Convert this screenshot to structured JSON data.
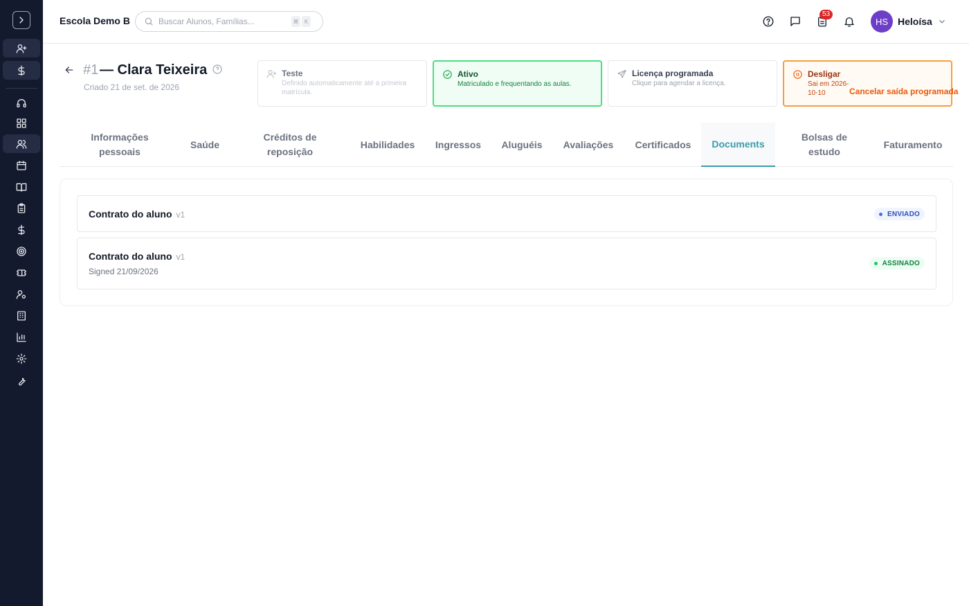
{
  "app": {
    "school_name": "Escola Demo B",
    "search_placeholder": "Buscar Alunos, Famílias...",
    "search_shortcut": [
      "⌘",
      "K"
    ],
    "notification_count": "53",
    "user_initials": "HS",
    "user_name": "Heloísa"
  },
  "sidebar": {
    "items": [
      {
        "icon": "user-plus-icon",
        "active": true
      },
      {
        "icon": "dollar-icon",
        "active": true
      },
      {
        "icon": "headset-icon",
        "active": false
      },
      {
        "icon": "dashboard-grid-icon",
        "active": false
      },
      {
        "icon": "users-icon",
        "active": true
      },
      {
        "icon": "calendar-icon",
        "active": false
      },
      {
        "icon": "book-icon",
        "active": false
      },
      {
        "icon": "clipboard-icon",
        "active": false
      },
      {
        "icon": "dollar-icon",
        "active": false
      },
      {
        "icon": "target-icon",
        "active": false
      },
      {
        "icon": "ticket-icon",
        "active": false
      },
      {
        "icon": "user-cog-icon",
        "active": false
      },
      {
        "icon": "building-icon",
        "active": false
      },
      {
        "icon": "bar-chart-icon",
        "active": false
      },
      {
        "icon": "gear-icon",
        "active": false
      },
      {
        "icon": "wrench-icon",
        "active": false
      }
    ]
  },
  "student": {
    "id": "#1",
    "name": "— Clara Teixeira",
    "created": "Criado 21 de set. de 2026"
  },
  "statuses": [
    {
      "title": "Teste",
      "description": "Definido automaticamente até a primeira matrícula."
    },
    {
      "title": "Ativo",
      "description": "Matriculado e frequentando as aulas."
    },
    {
      "title": "Licença programada",
      "description": "Clique para agendar a licença."
    },
    {
      "title": "Desligar",
      "description": "Sai em 2026-10-10",
      "action": "Cancelar saída programada"
    }
  ],
  "tabs": [
    {
      "label": "Informações pessoais",
      "active": false
    },
    {
      "label": "Saúde",
      "active": false
    },
    {
      "label": "Créditos de reposição",
      "active": false
    },
    {
      "label": "Habilidades",
      "active": false
    },
    {
      "label": "Ingressos",
      "active": false
    },
    {
      "label": "Aluguéis",
      "active": false
    },
    {
      "label": "Avaliações",
      "active": false
    },
    {
      "label": "Certificados",
      "active": false
    },
    {
      "label": "Documents",
      "active": true
    },
    {
      "label": "Bolsas de estudo",
      "active": false
    },
    {
      "label": "Faturamento",
      "active": false
    }
  ],
  "documents": [
    {
      "title": "Contrato do aluno",
      "version": "v1",
      "subtitle": "",
      "status": "ENVIADO"
    },
    {
      "title": "Contrato do aluno",
      "version": "v1",
      "subtitle": "Signed 21/09/2026",
      "status": "ASSINADO"
    }
  ],
  "colors": {
    "sidebar_bg": "#141a2e",
    "accent": "#3a9ca8",
    "active_status": "#4ade80",
    "leaving_status": "#f59e3a",
    "avatar": "#6d3fc8"
  }
}
